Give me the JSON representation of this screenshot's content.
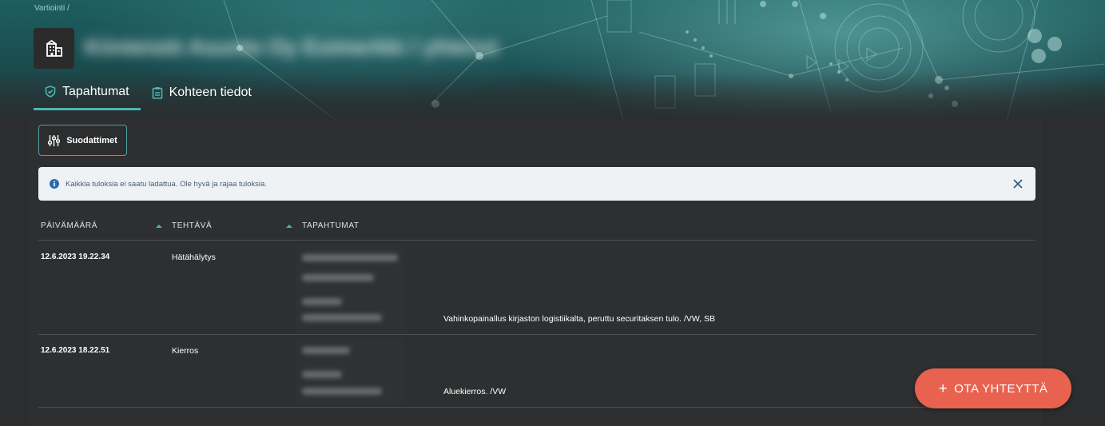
{
  "breadcrumb": {
    "text": "Vartiointi /"
  },
  "page": {
    "title": "Kiinteistö Asunto Oy Esimerkki / yhteisö"
  },
  "tabs": [
    {
      "label": "Tapahtumat",
      "icon": "shield-check-icon",
      "active": true
    },
    {
      "label": "Kohteen tiedot",
      "icon": "clipboard-icon",
      "active": false
    }
  ],
  "filters": {
    "label": "Suodattimet",
    "icon": "sliders-icon"
  },
  "alert": {
    "text": "Kaikkia tuloksia ei saatu ladattua. Ole hyvä ja rajaa tuloksia.",
    "icon": "info-icon"
  },
  "table": {
    "columns": [
      "PÄIVÄMÄÄRÄ",
      "TEHTÄVÄ",
      "TAPAHTUMAT"
    ],
    "rows": [
      {
        "date": "12.6.2023 19.22.34",
        "task": "Hätähälytys",
        "event_details_redacted": [
          "Hälytyskeskus 1",
          "Ovi ilmoitus 2",
          "Vartija",
          "Tapahtuma tehty"
        ],
        "description": "Vahinkopainallus kirjaston logistiikalta, peruttu securitaksen tulo. /VW, SB"
      },
      {
        "date": "12.6.2023 18.22.51",
        "task": "Kierros",
        "event_details_redacted": [
          "Kierros 17",
          "Vartija",
          "Tapahtuma tehty"
        ],
        "description": "Aluekierros. /VW"
      }
    ]
  },
  "contact_button": {
    "plus": "+",
    "label": "OTA YHTEYTTÄ"
  },
  "colors": {
    "accent": "#4cb7b3",
    "contact": "#e8624f",
    "alert_bg": "#eef2f5",
    "alert_text": "#4a5d72",
    "background": "#2c2d2e"
  }
}
